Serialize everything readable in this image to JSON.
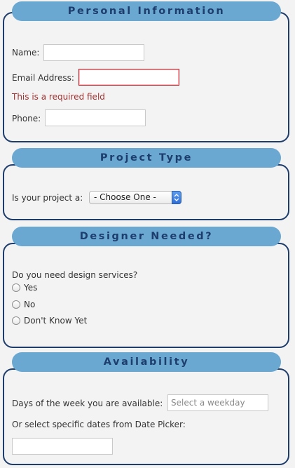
{
  "sections": {
    "personal": {
      "title": "Personal Information",
      "name_label": "Name:",
      "name_value": "",
      "email_label": "Email Address:",
      "email_value": "",
      "email_error": "This is a required field",
      "phone_label": "Phone:",
      "phone_value": ""
    },
    "project": {
      "title": "Project Type",
      "question_label": "Is your project a:",
      "select_value": "- Choose One -"
    },
    "designer": {
      "title": "Designer Needed?",
      "question": "Do you need design services?",
      "options": [
        "Yes",
        "No",
        "Don't Know Yet"
      ]
    },
    "availability": {
      "title": "Availability",
      "days_label": "Days of the week you are available:",
      "days_placeholder": "Select a weekday",
      "dates_label": "Or select specific dates from Date Picker:",
      "dates_value": ""
    }
  },
  "colors": {
    "header_bg": "#6aa8d2",
    "header_text": "#1d3d6d",
    "panel_border": "#1f3d6b",
    "error_text": "#a13030",
    "page_bg": "#f3f3f3"
  }
}
